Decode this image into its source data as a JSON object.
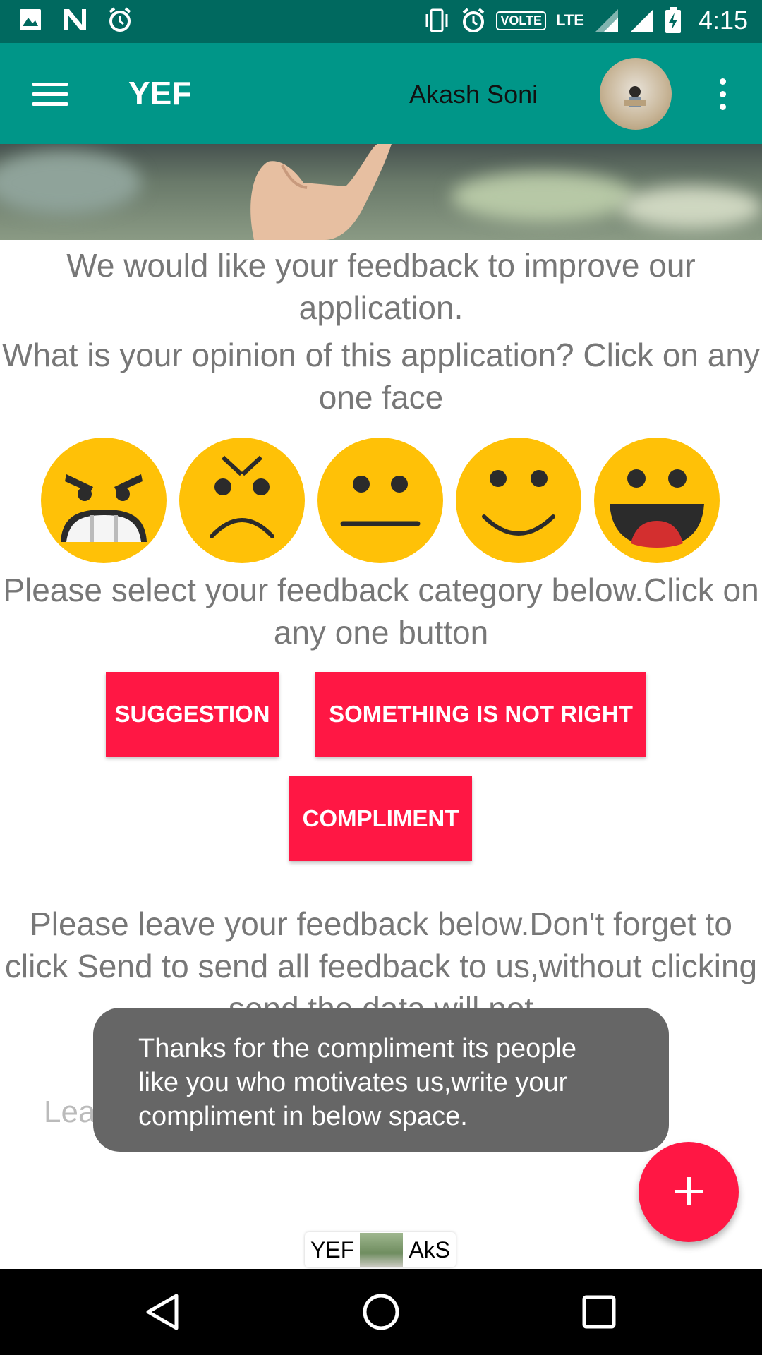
{
  "status_bar": {
    "time": "4:15",
    "volte": "VOLTE",
    "network": "LTE",
    "icons": [
      "gallery-icon",
      "n-icon",
      "alarm-icon",
      "vibrate-icon",
      "alarm-icon",
      "signal-icon",
      "signal-icon",
      "battery-charging-icon"
    ]
  },
  "app_bar": {
    "title": "YEF",
    "user_name": "Akash Soni",
    "menu_icon": "hamburger-menu-icon",
    "overflow_icon": "more-vert-icon"
  },
  "main": {
    "intro_text": "We would like your feedback to improve our application.",
    "opinion_text": "What is your opinion of this application? Click on any one face",
    "faces": [
      "very-angry-face-icon",
      "angry-face-icon",
      "neutral-face-icon",
      "smiling-face-icon",
      "laughing-face-icon"
    ],
    "category_text": "Please select your feedback category below.Click on any one button",
    "buttons": {
      "suggestion": "SUGGESTION",
      "not_right": "SOMETHING IS NOT RIGHT",
      "compliment": "COMPLIMENT"
    },
    "leave_feedback_text": "Please leave your feedback below.Don't forget to click Send to send all feedback to us,without clicking send the data will not",
    "input_hint": "Leave y"
  },
  "toast": {
    "message": "Thanks for the compliment its people like you who motivates us,write your compliment in below space."
  },
  "watermark": {
    "left": "YEF",
    "right": "AkS"
  },
  "colors": {
    "status_bar": "#00695f",
    "app_bar": "#009688",
    "accent": "#ff1744",
    "emoji": "#ffc107"
  }
}
